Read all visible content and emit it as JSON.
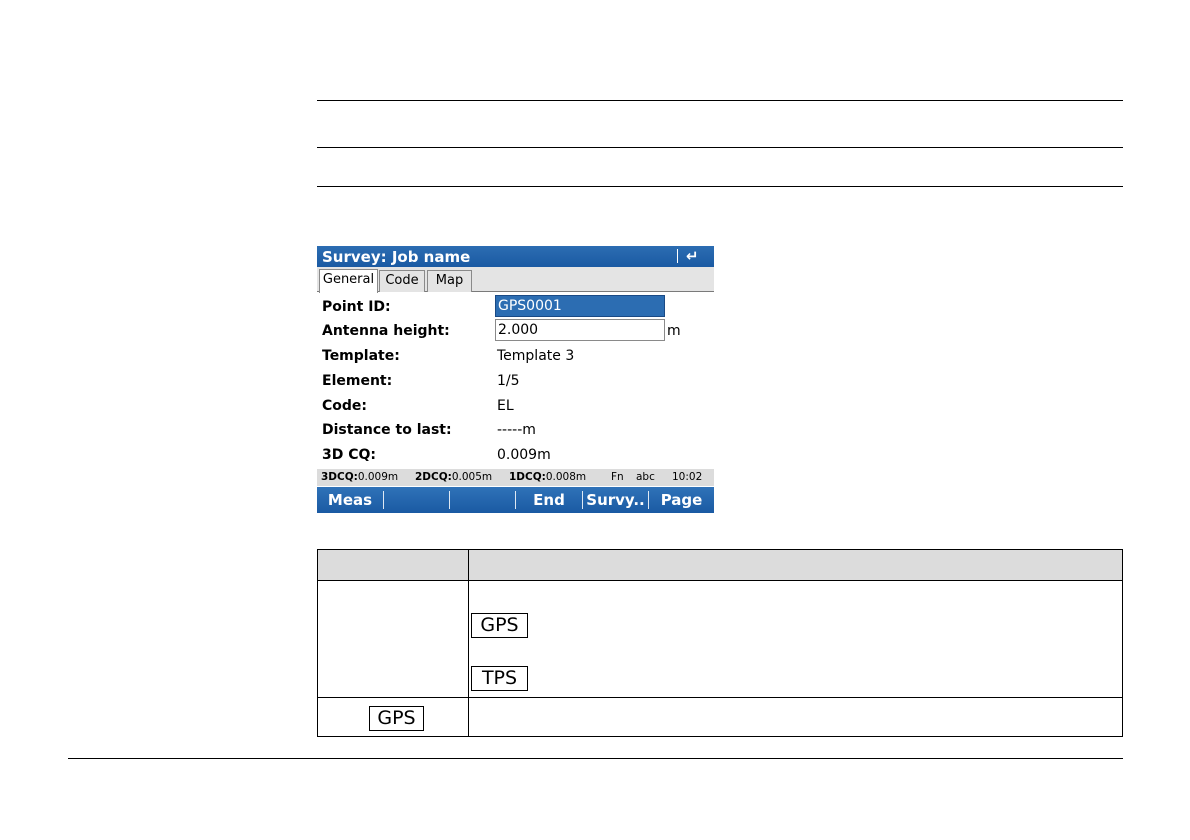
{
  "screen": {
    "title": "Survey: Job name",
    "back_icon": "↵",
    "tabs": [
      {
        "label": "General",
        "active": true
      },
      {
        "label": "Code",
        "active": false
      },
      {
        "label": "Map",
        "active": false
      }
    ],
    "fields": {
      "point_id": {
        "label": "Point ID:",
        "value": "GPS0001"
      },
      "antenna_height": {
        "label": "Antenna height:",
        "value": "2.000",
        "unit": "m"
      },
      "template": {
        "label": "Template:",
        "value": "Template 3"
      },
      "element": {
        "label": "Element:",
        "value": "1/5"
      },
      "code": {
        "label": "Code:",
        "value": "EL"
      },
      "distance_to_last": {
        "label": "Distance to last:",
        "value": "-----m"
      },
      "cq3d": {
        "label": "3D CQ:",
        "value": "0.009m"
      }
    },
    "status": {
      "dcq3_label": "3DCQ:",
      "dcq3_value": "0.009m",
      "dcq2_label": "2DCQ:",
      "dcq2_value": "0.005m",
      "dcq1_label": "1DCQ:",
      "dcq1_value": "0.008m",
      "fn": "Fn",
      "input_mode": "abc",
      "time": "10:02"
    },
    "softkeys": [
      "Meas",
      "",
      "",
      "End",
      "Survy..",
      "Page"
    ]
  },
  "table": {
    "key_gps": "GPS",
    "key_tps": "TPS",
    "key_gps_row2": "GPS"
  },
  "colors": {
    "titlebar": "#1a5aa3",
    "selection": "#2c6db2",
    "status_bg": "#dcdcdc",
    "table_header": "#dcdcdc"
  }
}
